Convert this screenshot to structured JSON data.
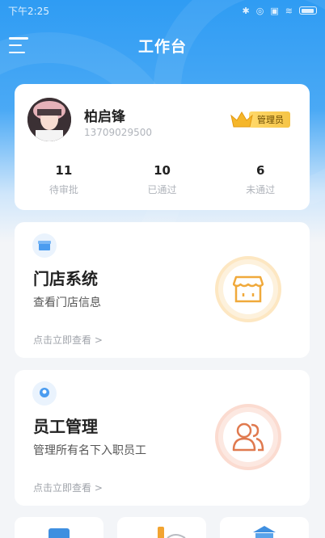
{
  "status_bar": {
    "time": "下午2:25"
  },
  "header": {
    "title": "工作台",
    "menu_icon": "menu-icon"
  },
  "profile": {
    "name": "柏启锋",
    "phone": "13709029500",
    "role": "管理员",
    "stats": [
      {
        "value": "11",
        "label": "待审批"
      },
      {
        "value": "10",
        "label": "已通过"
      },
      {
        "value": "6",
        "label": "未通过"
      }
    ]
  },
  "features": [
    {
      "title": "门店系统",
      "desc": "查看门店信息",
      "link": "点击立即查看 >",
      "icon": "store-icon",
      "accent": "#f0a93b"
    },
    {
      "title": "员工管理",
      "desc": "管理所有名下入职员工",
      "link": "点击立即查看 >",
      "icon": "staff-icon",
      "accent": "#e07a4f"
    }
  ],
  "colors": {
    "primary": "#2f9cf3",
    "badge": "#f5c446"
  }
}
